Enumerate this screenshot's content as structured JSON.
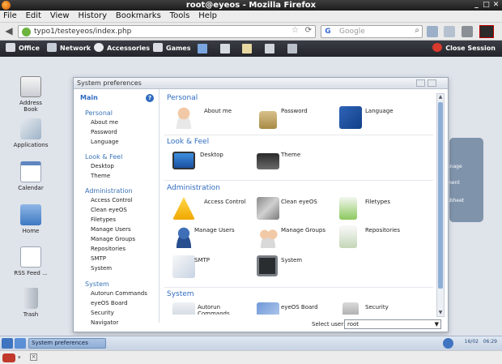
{
  "firefox": {
    "title": "root@eyeos - Mozilla Firefox",
    "menu": [
      "File",
      "Edit",
      "View",
      "History",
      "Bookmarks",
      "Tools",
      "Help"
    ],
    "url": "typo1/testeyeos/index.php",
    "search_placeholder": "Google",
    "search_engine_letter": "G"
  },
  "eyeos_bar": {
    "office": "Office",
    "network": "Network",
    "accessories": "Accessories",
    "games": "Games",
    "close_session": "Close Session"
  },
  "desktop_icons": [
    {
      "label": "Address\nBook"
    },
    {
      "label": "Applications"
    },
    {
      "label": "Calendar"
    },
    {
      "label": "Home"
    },
    {
      "label": "RSS Feed ..."
    },
    {
      "label": "Trash"
    }
  ],
  "window": {
    "title": "System preferences",
    "left_nav": {
      "main": "Main",
      "help_icon": "?",
      "sections": [
        {
          "title": "Personal",
          "items": [
            "About me",
            "Password",
            "Language"
          ]
        },
        {
          "title": "Look & Feel",
          "items": [
            "Desktop",
            "Theme"
          ]
        },
        {
          "title": "Administration",
          "items": [
            "Access Control",
            "Clean eyeOS",
            "Filetypes",
            "Manage Users",
            "Manage Groups",
            "Repositories",
            "SMTP",
            "System"
          ]
        },
        {
          "title": "System",
          "items": [
            "Autorun Commands",
            "eyeOS Board",
            "Security",
            "Navigator"
          ]
        }
      ]
    },
    "content": {
      "sections": [
        {
          "title": "Personal",
          "items": [
            "About me",
            "Password",
            "Language"
          ]
        },
        {
          "title": "Look & Feel",
          "items": [
            "Desktop",
            "Theme"
          ]
        },
        {
          "title": "Administration",
          "items": [
            "Access Control",
            "Clean eyeOS",
            "Filetypes",
            "Manage Users",
            "Manage Groups",
            "Repositories",
            "SMTP",
            "System"
          ]
        },
        {
          "title": "System",
          "items": [
            "Autorun\nCommands",
            "eyeOS Board",
            "Security"
          ]
        }
      ]
    },
    "select_user_label": "Select user:",
    "select_user_value": "root"
  },
  "background_panel": [
    "anage",
    "ment",
    "ubheet"
  ],
  "taskbar": {
    "task": "System preferences",
    "date": "16/02",
    "time": "06:29"
  }
}
